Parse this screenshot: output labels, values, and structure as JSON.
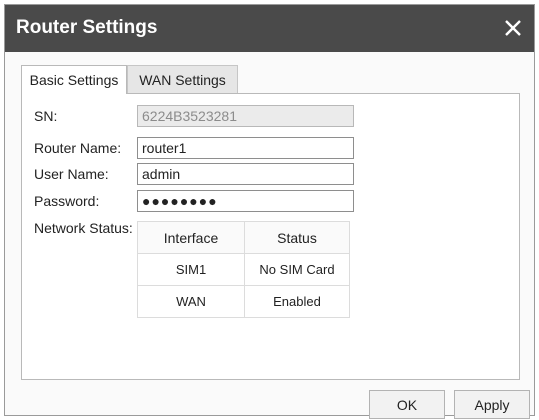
{
  "dialog": {
    "title": "Router Settings"
  },
  "icons": {
    "close": "close-icon"
  },
  "tabs": [
    {
      "label": "Basic Settings",
      "active": true
    },
    {
      "label": "WAN Settings",
      "active": false
    }
  ],
  "form": {
    "sn_label": "SN:",
    "sn_value": "6224B3523281",
    "router_name_label": "Router Name:",
    "router_name_value": "router1",
    "user_name_label": "User Name:",
    "user_name_value": "admin",
    "password_label": "Password:",
    "password_value": "●●●●●●●●",
    "network_status_label": "Network Status:"
  },
  "network_table": {
    "headers": [
      "Interface",
      "Status"
    ],
    "rows": [
      [
        "SIM1",
        "No SIM Card"
      ],
      [
        "WAN",
        "Enabled"
      ]
    ]
  },
  "buttons": {
    "ok": "OK",
    "apply": "Apply"
  },
  "colors": {
    "titlebar": "#4a4a4a",
    "title_text": "#ffffff"
  }
}
